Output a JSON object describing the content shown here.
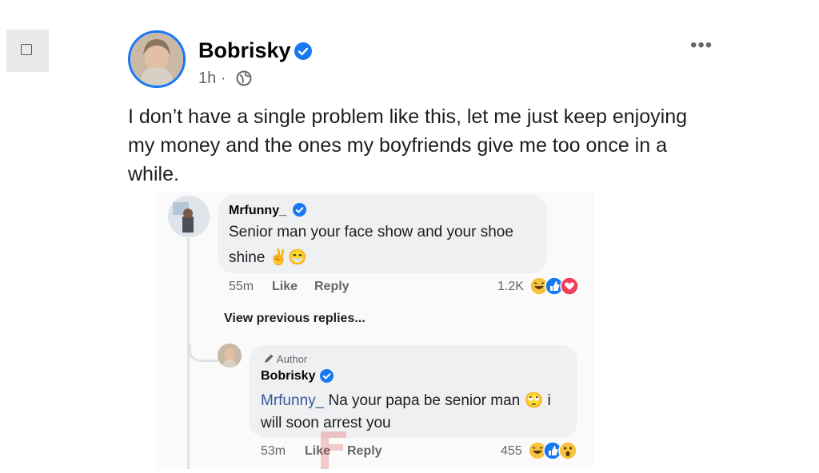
{
  "post": {
    "author": "Bobrisky",
    "time": "1h",
    "separator": "·",
    "more_label": "•••",
    "text": "I don’t have a single problem like this, let me just keep enjoying my money and the ones my boyfriends give me too once in a while."
  },
  "comments": [
    {
      "name": "Mrfunny_",
      "text": "Senior man your face show and your shoe shine ✌️😁",
      "time": "55m",
      "like_label": "Like",
      "reply_label": "Reply",
      "reactions_count": "1.2K"
    }
  ],
  "view_previous": "View previous replies...",
  "reply": {
    "badge": "Author",
    "name": "Bobrisky",
    "mention": "Mrfunny_",
    "text": " Na your papa be senior man 🙄 i will soon arrest you",
    "time": "53m",
    "like_label": "Like",
    "reply_label": "Reply",
    "reactions_count": "455"
  },
  "colors": {
    "accent": "#1877f2",
    "mention": "#385898",
    "bubble": "#eff0f2",
    "muted_text": "#65676b"
  },
  "icons": [
    "checkbox-icon",
    "verified-icon",
    "globe-icon",
    "more-icon",
    "pencil-icon",
    "haha-reaction-icon",
    "like-reaction-icon",
    "love-reaction-icon",
    "wow-reaction-icon"
  ]
}
